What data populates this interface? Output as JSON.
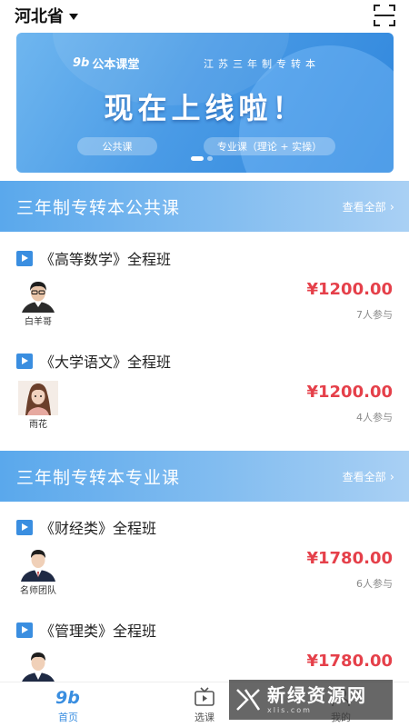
{
  "header": {
    "province": "河北省",
    "scan_icon": "scan-icon"
  },
  "banner": {
    "brand_logo": "9b",
    "brand_name": "公本课堂",
    "subtitle": "江苏三年制专转本",
    "title": "现在上线啦！",
    "pill_left": "公共课",
    "pill_right": "专业课（理论 + 实操）",
    "active_slide": 1,
    "slide_count": 2
  },
  "sections": [
    {
      "title": "三年制专转本公共课",
      "see_all": "查看全部",
      "courses": [
        {
          "title": "《高等数学》全程班",
          "teacher": "白羊哥",
          "price": "¥1200.00",
          "enrolled": "7人参与",
          "avatar": "male-teacher-avatar"
        },
        {
          "title": "《大学语文》全程班",
          "teacher": "雨花",
          "price": "¥1200.00",
          "enrolled": "4人参与",
          "avatar": "female-teacher-avatar"
        }
      ]
    },
    {
      "title": "三年制专转本专业课",
      "see_all": "查看全部",
      "courses": [
        {
          "title": "《财经类》全程班",
          "teacher": "名师团队",
          "price": "¥1780.00",
          "enrolled": "6人参与",
          "avatar": "team-avatar"
        },
        {
          "title": "《管理类》全程班",
          "teacher": "",
          "price": "¥1780.00",
          "enrolled": "",
          "avatar": "team-avatar"
        }
      ]
    }
  ],
  "tabbar": {
    "tabs": [
      {
        "label": "首页",
        "icon": "home-logo-icon",
        "active": true
      },
      {
        "label": "选课",
        "icon": "tv-icon",
        "active": false
      },
      {
        "label": "我的",
        "icon": "user-icon",
        "active": false
      }
    ]
  },
  "watermark": {
    "text": "新绿资源网",
    "sub": "xlis.com"
  },
  "colors": {
    "accent": "#3a8ee0",
    "price": "#e5404a",
    "section_gradient_start": "#5aa8ec",
    "section_gradient_end": "#a9d0f4"
  }
}
